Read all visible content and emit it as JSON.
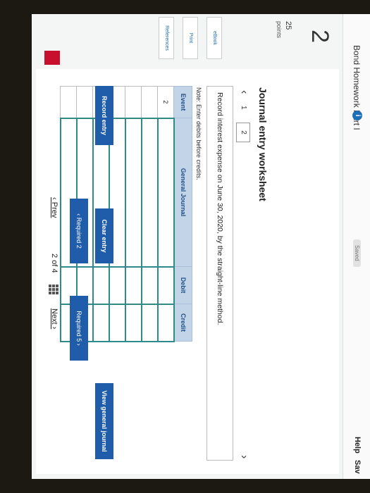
{
  "header": {
    "assignment_title": "Bond Homework Part I",
    "info_icon": "i",
    "status": "Saved",
    "help": "Help",
    "save": "Sav"
  },
  "sidebar": {
    "question_number": "2",
    "points_value": "25",
    "points_label": "points",
    "buttons": [
      "eBook",
      "Print",
      "References"
    ],
    "logo_icon": "mcgraw-hill-logo",
    "logo_color": "#c8102e"
  },
  "worksheet": {
    "title": "Journal entry worksheet",
    "steps": [
      "1",
      "2"
    ],
    "instruction": "Record interest expense on June 30, 2020, by the straight-line method.",
    "note": "Note: Enter debits before credits.",
    "table": {
      "headers": [
        "Event",
        "General Journal",
        "Debit",
        "Credit"
      ],
      "rows": [
        [
          "2",
          "",
          "",
          ""
        ],
        [
          "",
          "",
          "",
          ""
        ],
        [
          "",
          "",
          "",
          ""
        ],
        [
          "",
          "",
          "",
          ""
        ],
        [
          "",
          "",
          "",
          ""
        ],
        [
          "",
          "",
          "",
          ""
        ],
        [
          "",
          "",
          "",
          ""
        ]
      ]
    },
    "buttons": {
      "record": "Record entry",
      "clear": "Clear entry",
      "view": "View general journal"
    }
  },
  "navigation": {
    "required_prev": "Required 2",
    "required_next": "Required 5",
    "prev": "Prev",
    "page": "2 of 4",
    "next": "Next"
  },
  "colors": {
    "accent": "#1f5ca9",
    "table_header_bg": "#c2d4e8",
    "input_border": "#2f8a8a"
  }
}
